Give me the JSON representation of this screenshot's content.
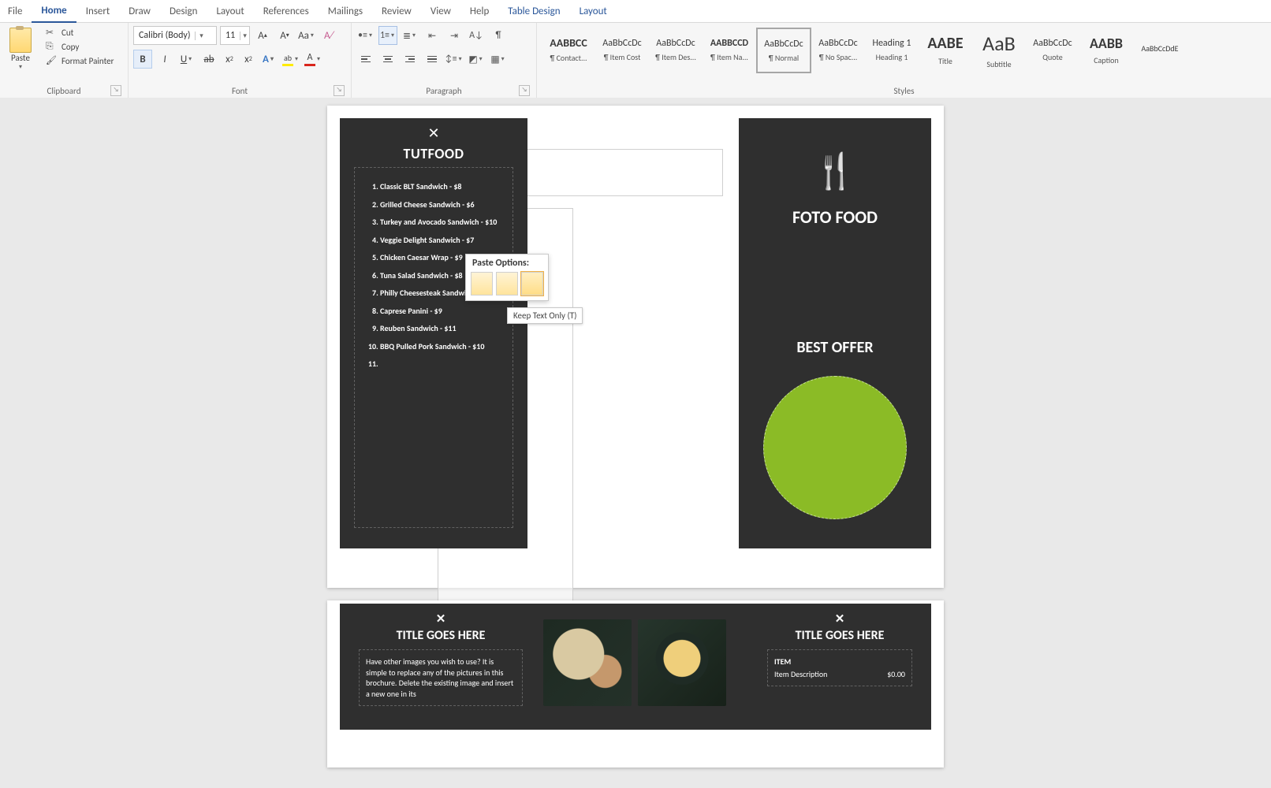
{
  "tabs": [
    "File",
    "Home",
    "Insert",
    "Draw",
    "Design",
    "Layout",
    "References",
    "Mailings",
    "Review",
    "View",
    "Help",
    "Table Design",
    "Layout"
  ],
  "active_tab": "Home",
  "ribbon": {
    "clipboard": {
      "title": "Clipboard",
      "paste": "Paste",
      "cut": "Cut",
      "copy": "Copy",
      "painter": "Format Painter"
    },
    "font": {
      "title": "Font",
      "name": "Calibri (Body)",
      "size": "11"
    },
    "paragraph": {
      "title": "Paragraph"
    },
    "styles_title": "Styles",
    "styles": [
      {
        "prev": "AABBCC",
        "sz": 14,
        "mod": "b",
        "name": "¶ Contact..."
      },
      {
        "prev": "AaBbCcDc",
        "sz": 12,
        "name": "¶ Item Cost"
      },
      {
        "prev": "AaBbCcDc",
        "sz": 12,
        "name": "¶ Item Des..."
      },
      {
        "prev": "AABBCCD",
        "sz": 12,
        "mod": "b",
        "name": "¶ Item Na..."
      },
      {
        "prev": "AaBbCcDc",
        "sz": 12,
        "name": "¶ Normal",
        "sel": true
      },
      {
        "prev": "AaBbCcDc",
        "sz": 12,
        "name": "¶ No Spac..."
      },
      {
        "prev": "Heading 1",
        "sz": 12,
        "name": "Heading 1"
      },
      {
        "prev": "AABE",
        "sz": 20,
        "mod": "b",
        "name": "Title"
      },
      {
        "prev": "AaB",
        "sz": 26,
        "name": "Subtitle"
      },
      {
        "prev": "AaBbCcDc",
        "sz": 12,
        "name": "Quote"
      },
      {
        "prev": "AABB",
        "sz": 18,
        "mod": "b",
        "name": "Caption"
      },
      {
        "prev": "AaBbCcDdE",
        "sz": 10,
        "name": ""
      }
    ]
  },
  "doc": {
    "left_brand": "TUTFOOD",
    "menu": [
      "Classic BLT Sandwich - $8",
      "Grilled Cheese Sandwich - $6",
      "Turkey and Avocado Sandwich - $10",
      "Veggie Delight Sandwich - $7",
      "Chicken Caesar Wrap - $9",
      "Tuna Salad Sandwich - $8",
      "Philly Cheesesteak Sandwich - $12",
      "Caprese Panini - $9",
      "Reuben Sandwich - $11",
      "BBQ Pulled Pork Sandwich - $10",
      ""
    ],
    "right_brand": "FOTO FOOD",
    "right_best": "BEST OFFER",
    "paste_hdr": "Paste Options:",
    "paste_tip": "Keep Text Only (T)",
    "p2_titleL": "TITLE GOES HERE",
    "p2_titleR": "TITLE GOES HERE",
    "p2_textL": "Have other images you wish to use?  It is simple to replace any of the pictures in this brochure. Delete the existing image and insert a new one in its",
    "p2_item": "ITEM",
    "p2_desc": "Item Description",
    "p2_price": "$0.00"
  }
}
